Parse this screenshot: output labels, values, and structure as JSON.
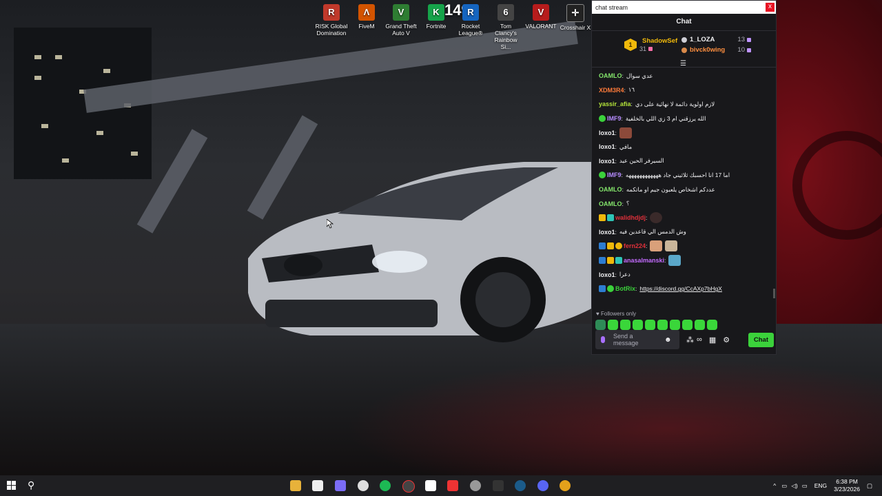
{
  "desktop": {
    "icons": [
      {
        "label": "RISK Global Domination",
        "glyph": "R",
        "color": "#c0392b"
      },
      {
        "label": "FiveM",
        "glyph": "Λ",
        "color": "#d35400"
      },
      {
        "label": "Grand Theft Auto V",
        "glyph": "V",
        "color": "#2e7d32"
      },
      {
        "label": "Fortnite",
        "glyph": "K",
        "color": "#16a34a"
      },
      {
        "label": "Rocket League®",
        "glyph": "R",
        "color": "#1565c0"
      },
      {
        "label": "Tom Clancy's Rainbow Si...",
        "glyph": "6",
        "color": "#444"
      },
      {
        "label": "VALORANT",
        "glyph": "V",
        "color": "#b71c1c"
      },
      {
        "label": "Crosshair X",
        "glyph": "✛",
        "color": "#222"
      }
    ],
    "overlay_number": "149"
  },
  "chat_window": {
    "title": "chat stream",
    "close_glyph": "x",
    "header": "Chat",
    "leaderboard": {
      "top": {
        "rank": "1",
        "name": "ShadowSef",
        "count": "31"
      },
      "others": [
        {
          "name": "1_LOZA",
          "count": "13",
          "color": "#efeff1"
        },
        {
          "name": "bivck0wing",
          "count": "10",
          "color": "#ff8f3f"
        }
      ]
    },
    "messages": [
      {
        "user": "OAMLO",
        "color": "#84e56b",
        "text": "عدي سوال"
      },
      {
        "user": "XDM3R4",
        "color": "#ff7b3a",
        "text": "١٦"
      },
      {
        "user": "yassir_afia",
        "color": "#b5e53a",
        "text": "لازم اولوية دائمة لا نهائية على دي"
      },
      {
        "user": "IMF9",
        "color": "#b68cff",
        "text": "الله يرزقني ام 3 زي اللي بالخلفية"
      },
      {
        "user": "loxo1",
        "color": "#efeff1",
        "text": ""
      },
      {
        "user": "loxo1",
        "color": "#efeff1",
        "text": "مافي"
      },
      {
        "user": "loxo1",
        "color": "#efeff1",
        "text": "السيرفر الحين عيد"
      },
      {
        "user": "IMF9",
        "color": "#b68cff",
        "text": "اما 17 انا احسبك ثلاثيني جاد ههههههههههههه"
      },
      {
        "user": "OAMLO",
        "color": "#84e56b",
        "text": "عددكم اشخاص يلعبون جيم او ماتكمه"
      },
      {
        "user": "OAMLO",
        "color": "#84e56b",
        "text": "؟"
      },
      {
        "user": "walidhdjdj",
        "color": "#e0303a",
        "text": ""
      },
      {
        "user": "loxo1",
        "color": "#efeff1",
        "text": "وش الدمس الي قاعدين فيه"
      },
      {
        "user": "fern224",
        "color": "#e0303a",
        "text": ""
      },
      {
        "user": "anasalmanski",
        "color": "#c46bff",
        "text": ""
      },
      {
        "user": "loxo1",
        "color": "#efeff1",
        "text": "دعرا"
      },
      {
        "user": "BotRix",
        "color": "#3bd13b",
        "text": "https://discord.gg/CcAXp7bHgX"
      }
    ],
    "followers_only": "Followers only",
    "input_placeholder": "Send a message",
    "chat_button": "Chat"
  },
  "taskbar": {
    "language": "ENG",
    "time": "6:38 PM",
    "date": "3/23/2026"
  }
}
